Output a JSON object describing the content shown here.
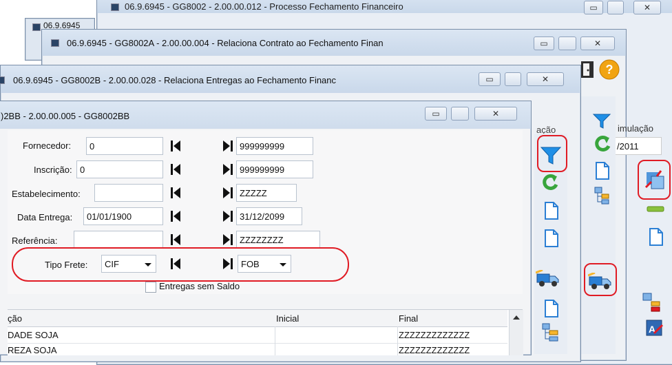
{
  "windows": {
    "w1": {
      "title": "06.9.6945 - GG8002 - 2.00.00.012 - Processo Fechamento Financeiro",
      "small_tab": "06.9.6945"
    },
    "w2": {
      "title": "06.9.6945 - GG8002A - 2.00.00.004 - Relaciona Contrato ao Fechamento Finan",
      "right_label": "imulação",
      "date_value": "/2011"
    },
    "w3": {
      "title": "06.9.6945 - GG8002B - 2.00.00.028 - Relaciona Entregas ao Fechamento Financ",
      "side_label": "ação"
    },
    "w4": {
      "title": ")2BB - 2.00.00.005 - GG8002BB"
    }
  },
  "form": {
    "fornecedor": {
      "label": "Fornecedor:",
      "from": "0",
      "to": "999999999"
    },
    "inscricao": {
      "label": "Inscrição:",
      "from": "0",
      "to": "999999999"
    },
    "estabelecimento": {
      "label": "Estabelecimento:",
      "from": "",
      "to": "ZZZZZ"
    },
    "data_entrega": {
      "label": "Data Entrega:",
      "from": "01/01/1900",
      "to": "31/12/2099"
    },
    "referencia": {
      "label": "Referência:",
      "from": "",
      "to": "ZZZZZZZZ"
    },
    "tipo_frete": {
      "label": "Tipo Frete:",
      "from": "CIF",
      "to": "FOB"
    },
    "checkbox_label": "Entregas sem Saldo"
  },
  "grid": {
    "headers": [
      "ção",
      "Inicial",
      "Final"
    ],
    "rows": [
      [
        "DADE SOJA",
        "",
        "ZZZZZZZZZZZZZ"
      ],
      [
        "REZA SOJA",
        "",
        "ZZZZZZZZZZZZZ"
      ]
    ]
  },
  "icons": [
    "filter-icon",
    "refresh-icon",
    "document-icon",
    "hierarchy-icon",
    "truck-icon",
    "exit-door-icon",
    "help-icon",
    "link-icon",
    "minus-icon",
    "edit-icon"
  ],
  "colors": {
    "highlight": "#e01b24",
    "filter_blue": "#1f8fe6",
    "refresh_green": "#38a53c"
  }
}
